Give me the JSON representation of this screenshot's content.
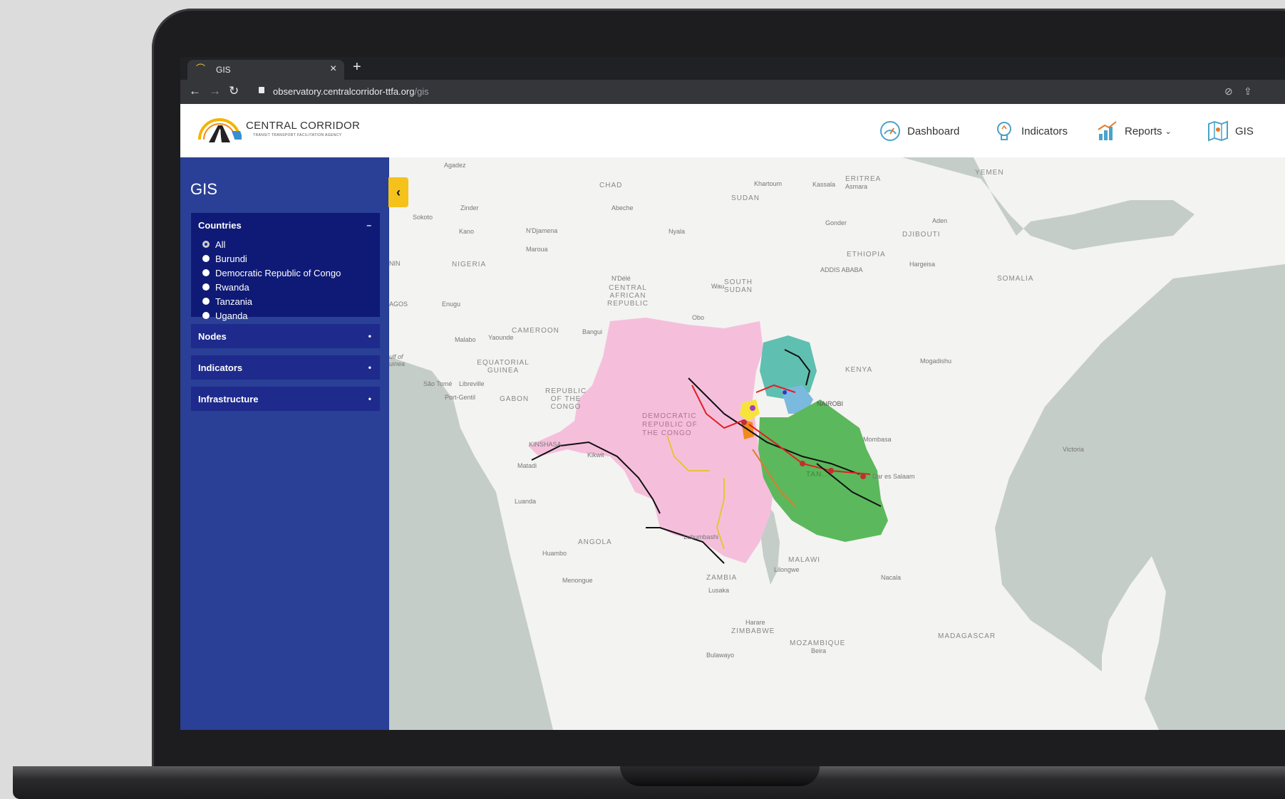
{
  "browser": {
    "tab_title": "GIS",
    "tab_close": "×",
    "new_tab": "+",
    "url_domain": "observatory.centralcorridor-ttfa.org",
    "url_path": "/gis"
  },
  "header": {
    "brand": "CENTRAL CORRIDOR",
    "brand_sub": "TRANSIT TRANSPORT FACILITATION AGENCY",
    "nav": [
      {
        "label": "Dashboard",
        "icon": "dashboard-gauge-icon"
      },
      {
        "label": "Indicators",
        "icon": "lightbulb-icon"
      },
      {
        "label": "Reports",
        "icon": "bar-chart-icon",
        "caret": "⌄"
      },
      {
        "label": "GIS",
        "icon": "map-icon"
      }
    ]
  },
  "sidebar": {
    "title": "GIS",
    "panels": [
      {
        "label": "Countries",
        "toggle": "–",
        "open": true,
        "options": [
          "All",
          "Burundi",
          "Democratic Republic of Congo",
          "Rwanda",
          "Tanzania",
          "Uganda"
        ],
        "selected": "All"
      },
      {
        "label": "Nodes",
        "toggle": "•"
      },
      {
        "label": "Indicators",
        "toggle": "•"
      },
      {
        "label": "Infrastructure",
        "toggle": "•"
      }
    ]
  },
  "map": {
    "collapse_button": "‹",
    "labels": {
      "chad": "CHAD",
      "sudan": "SUDAN",
      "eritrea": "ERITREA",
      "yemen": "YEMEN",
      "nigeria": "NIGERIA",
      "ethiopia": "ETHIOPIA",
      "somalia": "SOMALIA",
      "car": "CENTRAL AFRICAN REPUBLIC",
      "south_sudan": "SOUTH SUDAN",
      "cameroon": "CAMEROON",
      "eq_guinea": "EQUATORIAL GUINEA",
      "gabon": "GABON",
      "rep_congo": "REPUBLIC OF THE CONGO",
      "drc": "DEMOCRATIC REPUBLIC OF THE CONGO",
      "kenya": "KENYA",
      "tanzania": "TAN...",
      "angola": "ANGOLA",
      "zambia": "ZAMBIA",
      "malawi": "MALAWI",
      "zimbabwe": "ZIMBABWE",
      "mozambique": "MOZAMBIQUE",
      "madagascar": "MADAGASCAR",
      "djibouti": "DJIBOUTI"
    },
    "cities": {
      "agadez": "Agadez",
      "zinder": "Zinder",
      "sokoto": "Sokoto",
      "kano": "Kano",
      "ndjamena": "N'Djamena",
      "abeche": "Abeche",
      "maroua": "Maroua",
      "khartoum": "Khartoum",
      "kassala": "Kassala",
      "asmara": "Asmara",
      "nyala": "Nyala",
      "gonder": "Gonder",
      "addis": "ADDIS ABABA",
      "hargeisa": "Hargeisa",
      "aden": "Aden",
      "ndele": "N'Délé",
      "wau": "Wau",
      "enugu": "Enugu",
      "lagos": "AGOS",
      "malabo": "Malabo",
      "yaounde": "Yaounde",
      "bangui": "Bangui",
      "obo": "Obo",
      "saotome": "São Tomé",
      "libreville": "Libreville",
      "portgentil": "Port-Gentil",
      "kinshasa": "KINSHASA",
      "matadi": "Matadi",
      "luanda": "Luanda",
      "huambo": "Huambo",
      "menongue": "Menongue",
      "lubumbashi": "Lubumbashi",
      "lusaka": "Lusaka",
      "lilongwe": "Lilongwe",
      "harare": "Harare",
      "bulawayo": "Bulawayo",
      "beira": "Beira",
      "nacala": "Nacala",
      "nairobi": "NAIROBI",
      "mombasa": "Mombasa",
      "daressalaam": "Dar es Salaam",
      "mogadishu": "Mogadishu",
      "victoria": "Victoria",
      "kikwit": "Kikwit",
      "nin": "NIN",
      "gulf": "ulf of uinea"
    }
  },
  "colors": {
    "sidebar": "#2a3f96",
    "panel": "#1e2a8c",
    "collapse": "#f4c21b",
    "drc_fill": "#f5bfdc",
    "tanzania_fill": "#5cb85c",
    "uganda_fill": "#5fbfb0"
  }
}
